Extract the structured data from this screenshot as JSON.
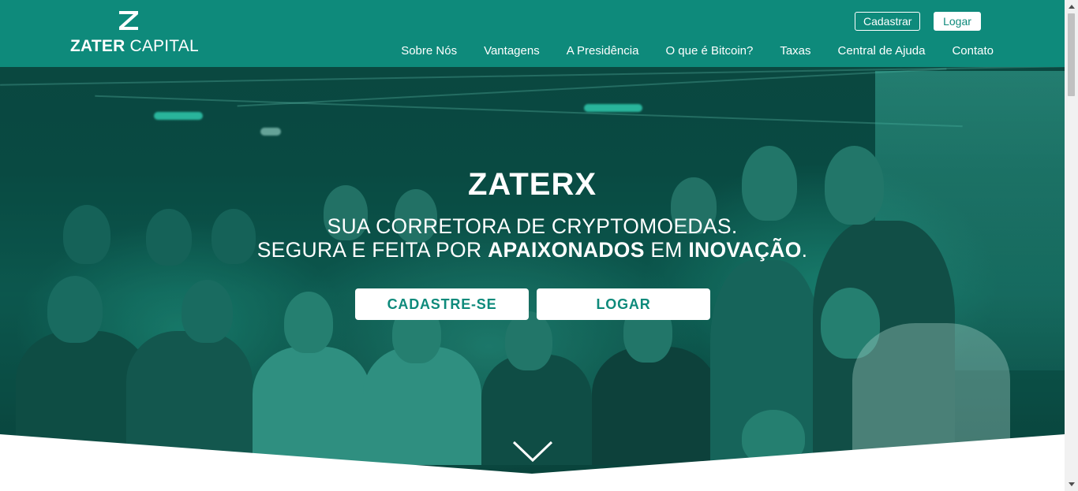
{
  "brand": {
    "bold": "ZATER",
    "light": "CAPITAL"
  },
  "top_buttons": {
    "register": "Cadastrar",
    "login": "Logar"
  },
  "nav": [
    "Sobre Nós",
    "Vantagens",
    "A Presidência",
    "O que é Bitcoin?",
    "Taxas",
    "Central de Ajuda",
    "Contato"
  ],
  "hero": {
    "title": "ZATERX",
    "line1": "SUA CORRETORA DE CRYPTOMOEDAS.",
    "line2_a": "SEGURA E FEITA POR ",
    "line2_b": "APAIXONADOS",
    "line2_c": " EM ",
    "line2_d": "INOVAÇÃO",
    "line2_e": ".",
    "cta_register": "CADASTRE-SE",
    "cta_login": "LOGAR"
  },
  "colors": {
    "brand_teal": "#0e8a7b",
    "white": "#ffffff"
  },
  "icons": {
    "logo": "zater-z-logo-icon",
    "scroll": "chevron-down-icon"
  }
}
